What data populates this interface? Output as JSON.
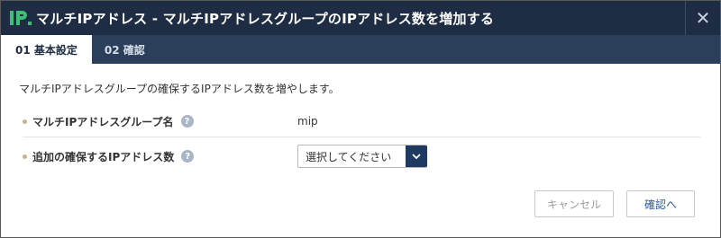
{
  "dialog": {
    "title": "マルチIPアドレス - マルチIPアドレスグループのIPアドレス数を増加する",
    "logo_text": "IP.",
    "close_label": "✕"
  },
  "tabs": [
    {
      "label": "01 基本設定",
      "active": true
    },
    {
      "label": "02 確認",
      "active": false
    }
  ],
  "main": {
    "description": "マルチIPアドレスグループの確保するIPアドレス数を増やします。",
    "fields": [
      {
        "label": "マルチIPアドレスグループ名",
        "value": "mip"
      },
      {
        "label": "追加の確保するIPアドレス数",
        "select_value": "選択してください"
      }
    ]
  },
  "buttons": {
    "cancel": "キャンセル",
    "confirm": "確認へ"
  },
  "colors": {
    "titlebar": "#1e2d44",
    "tabbar": "#2c3f5a",
    "logo_green": "#3fbf74",
    "select_arrow": "#1e3a60",
    "bullet": "#c7b48a"
  }
}
